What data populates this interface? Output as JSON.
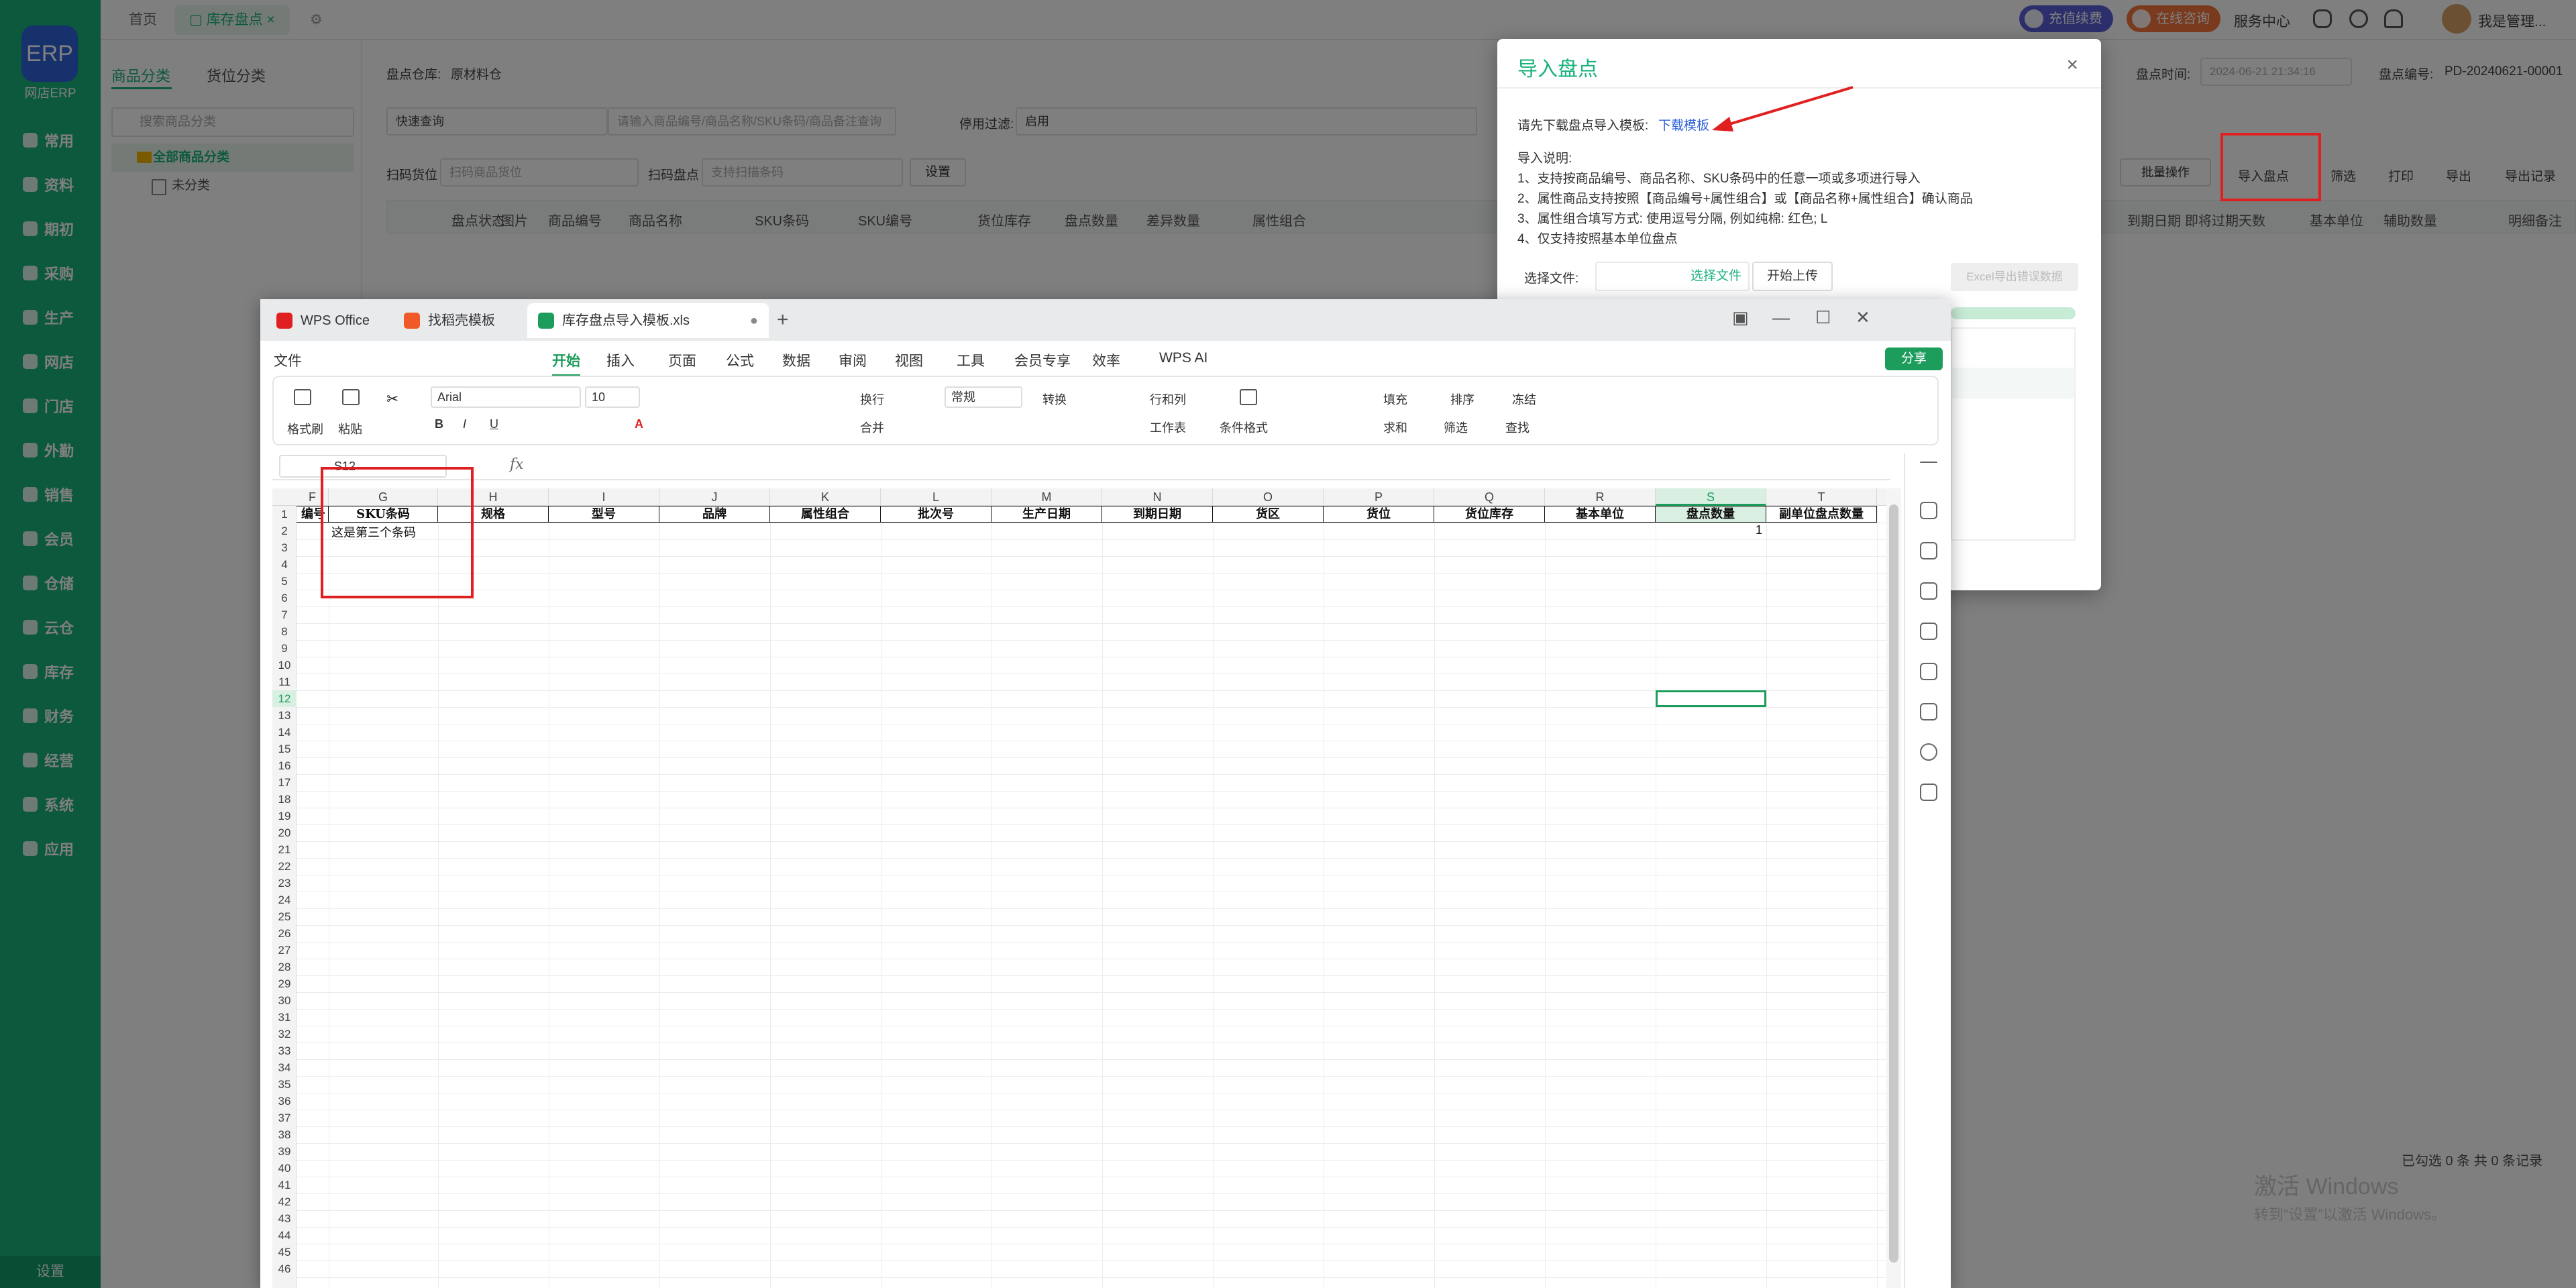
{
  "app": {
    "logo_label": "ERP",
    "logo_caption": "网店ERP",
    "nav": [
      "常用",
      "资料",
      "期初",
      "采购",
      "生产",
      "网店",
      "门店",
      "外勤",
      "销售",
      "会员",
      "仓储",
      "云仓",
      "库存",
      "财务",
      "经营",
      "系统",
      "应用"
    ],
    "settings_label": "设置",
    "tabs": {
      "home": "首页",
      "inventory": "库存盘点",
      "gear": "⚙"
    },
    "topbar": {
      "recharge": "充值续费",
      "consult": "在线咨询",
      "service": "服务中心",
      "user": "我是管理..."
    }
  },
  "left_panel": {
    "tab_goods": "商品分类",
    "tab_location": "货位分类",
    "search_placeholder": "搜索商品分类",
    "tree_all": "全部商品分类",
    "tree_uncat": "未分类"
  },
  "form": {
    "warehouse_label": "盘点仓库:",
    "warehouse_value": "原材料仓",
    "quick_query": "快速查询",
    "query_placeholder": "请输入商品编号/商品名称/SKU条码/商品备注查询",
    "filter_label": "停用过滤:",
    "filter_value": "启用",
    "scan_loc_label": "扫码货位",
    "scan_loc_placeholder": "扫码商品货位",
    "scan_count_label": "扫码盘点",
    "scan_count_placeholder": "支持扫描条码",
    "settings_btn": "设置",
    "time_label": "盘点时间:",
    "time_value": "2024-06-21 21:34:16",
    "no_label": "盘点编号:",
    "no_value": "PD-20240621-00001",
    "batch_btn": "批量操作",
    "import_btn": "导入盘点",
    "filter_btn": "筛选",
    "print_btn": "打印",
    "export_btn": "导出",
    "export_rec_btn": "导出记录"
  },
  "grid": {
    "left_headers": [
      "盘点状态",
      "图片",
      "商品编号",
      "商品名称",
      "SKU条码",
      "SKU编号",
      "货位库存",
      "盘点数量",
      "差异数量",
      "属性组合"
    ],
    "right_headers": [
      "到期日期",
      "即将过期天数",
      "基本单位",
      "辅助数量",
      "明细备注"
    ],
    "status": "已勾选 0 条 共 0 条记录"
  },
  "watermark": {
    "line1": "激活 Windows",
    "line2": "转到“设置”以激活 Windows。"
  },
  "dialog": {
    "title": "导入盘点",
    "close": "×",
    "prompt": "请先下载盘点导入模板:",
    "download_link": "下载模板",
    "notes": [
      "导入说明:",
      "1、支持按商品编号、商品名称、SKU条码中的任意一项或多项进行导入",
      "2、属性商品支持按照【商品编号+属性组合】或【商品名称+属性组合】确认商品",
      "3、属性组合填写方式: 使用逗号分隔, 例如纯棉: 红色; L",
      "4、仅支持按照基本单位盘点"
    ],
    "file_label": "选择文件:",
    "file_btn": "选择文件",
    "upload_btn": "开始上传",
    "error_btn": "Excel导出错误数据",
    "progress": 1.0
  },
  "wps": {
    "tabs": [
      "WPS Office",
      "找稻壳模板",
      "库存盘点导入模板.xls"
    ],
    "menu": [
      "文件",
      "开始",
      "插入",
      "页面",
      "公式",
      "数据",
      "审阅",
      "视图",
      "工具",
      "会员专享",
      "效率",
      "WPS AI"
    ],
    "share": "分享",
    "ribbon": {
      "format_painter": "格式刷",
      "paste": "粘贴",
      "font": "Arial",
      "size": "10",
      "wrap": "换行",
      "merge": "合并",
      "number_format": "常规",
      "convert": "转换",
      "row_col": "行和列",
      "worksheet": "工作表",
      "cond_format": "条件格式",
      "fill": "填充",
      "sort": "排序",
      "freeze": "冻结",
      "sum": "求和",
      "filter": "筛选",
      "find": "查找"
    },
    "name_box": "S12",
    "fx": "fx",
    "columns": [
      "F",
      "G",
      "H",
      "I",
      "J",
      "K",
      "L",
      "M",
      "N",
      "O",
      "P",
      "Q",
      "R",
      "S",
      "T"
    ],
    "header_row": [
      "编号",
      "SKU条码",
      "规格",
      "型号",
      "品牌",
      "属性组合",
      "批次号",
      "生产日期",
      "到期日期",
      "货区",
      "货位",
      "货位库存",
      "基本单位",
      "盘点数量",
      "副单位盘点数量"
    ],
    "row2": {
      "G": "这是第三个条码",
      "S": "1"
    },
    "row_count": 46,
    "accent": "#1d9d5c"
  }
}
